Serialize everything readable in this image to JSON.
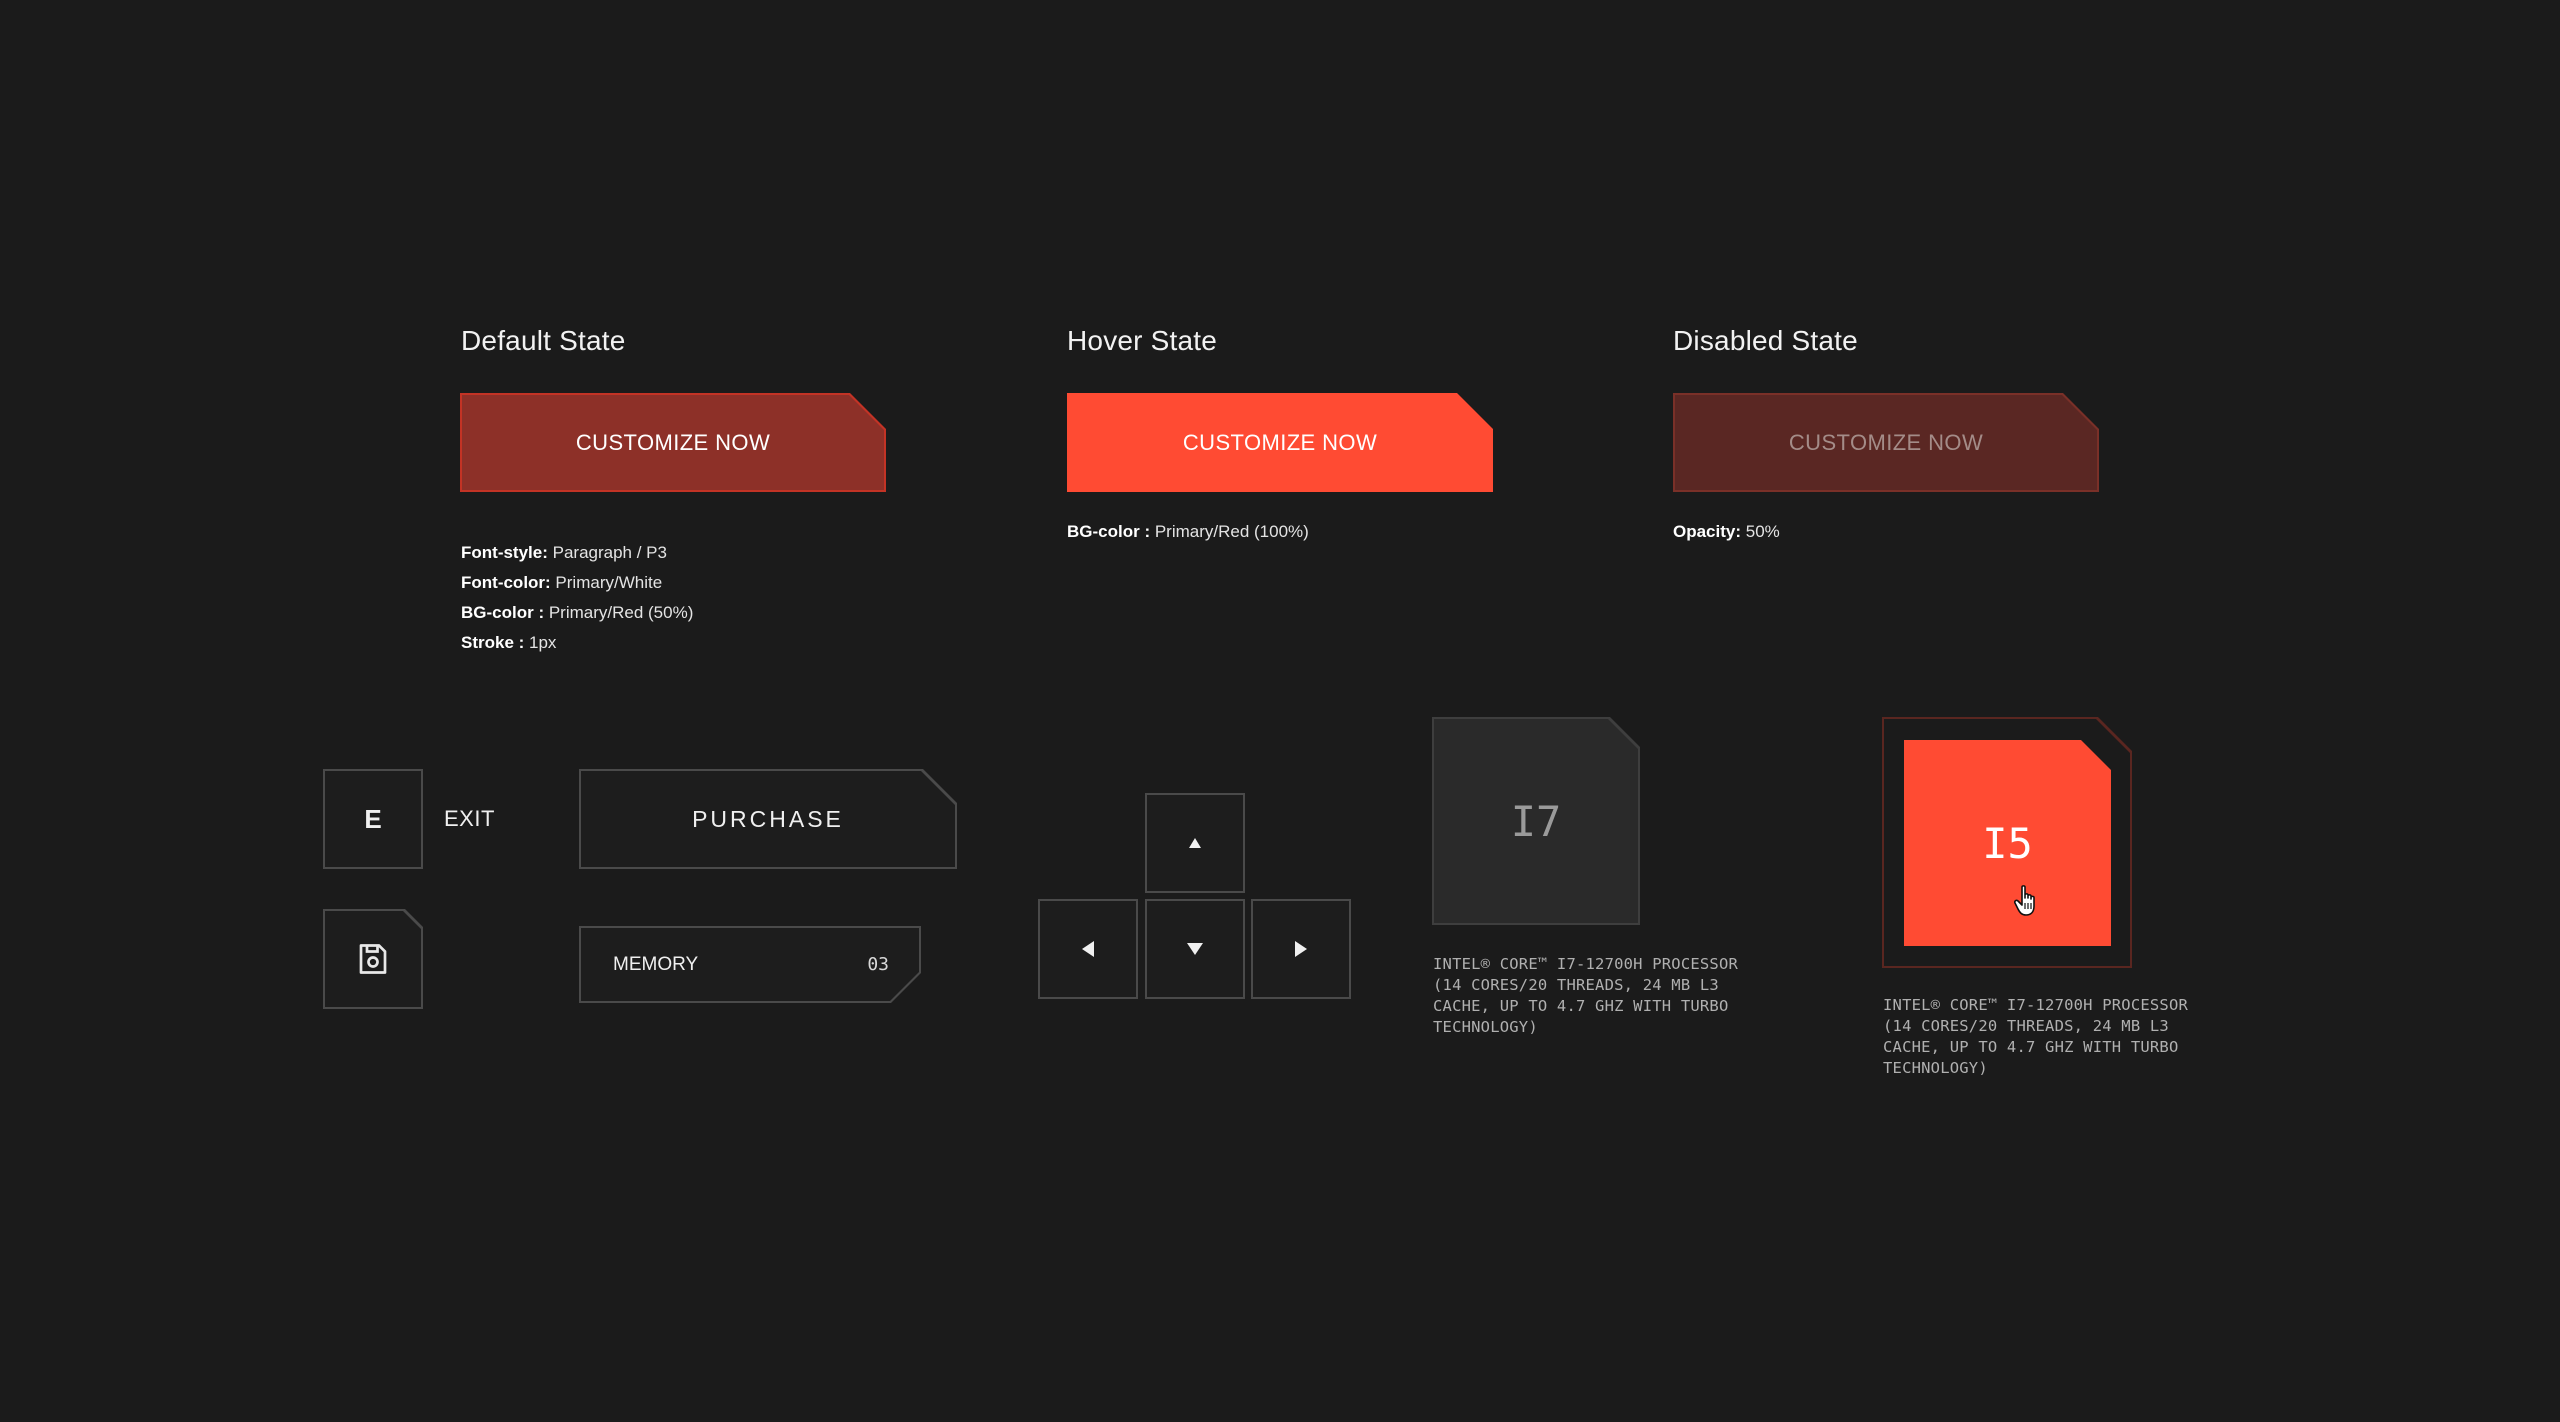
{
  "states": {
    "default": {
      "title": "Default State",
      "button": "CUSTOMIZE NOW",
      "specs": [
        {
          "label": "Font-style:",
          "value": " Paragraph / P3"
        },
        {
          "label": "Font-color:",
          "value": " Primary/White"
        },
        {
          "label": "BG-color :",
          "value": " Primary/Red (50%)"
        },
        {
          "label": "Stroke :",
          "value": " 1px"
        }
      ]
    },
    "hover": {
      "title": "Hover State",
      "button": "CUSTOMIZE NOW",
      "specs": [
        {
          "label": "BG-color :",
          "value": " Primary/Red (100%)"
        }
      ]
    },
    "disabled": {
      "title": "Disabled State",
      "button": "CUSTOMIZE NOW",
      "specs": [
        {
          "label": "Opacity:",
          "value": " 50%"
        }
      ]
    }
  },
  "controls": {
    "key_e": "E",
    "exit_label": "EXIT",
    "purchase": "PURCHASE",
    "memory_label": "MEMORY",
    "memory_value": "03"
  },
  "cpus": [
    {
      "label": "I7",
      "description": "INTEL® CORE™ I7-12700H PROCESSOR (14 CORES/20 THREADS, 24 MB L3 CACHE, UP TO 4.7 GHZ WITH TURBO TECHNOLOGY)",
      "selected": false
    },
    {
      "label": "I5",
      "description": "INTEL® CORE™ I7-12700H PROCESSOR (14 CORES/20 THREADS, 24 MB L3 CACHE, UP TO 4.7 GHZ WITH TURBO TECHNOLOGY)",
      "selected": true
    }
  ],
  "colors": {
    "background": "#1b1b1b",
    "primary_red": "#ff4b33",
    "primary_red_50": "#8d3028",
    "panel": "#2a2a2a",
    "stroke": "#4a4a4a"
  },
  "icons": [
    "save-icon",
    "arrow-up-icon",
    "arrow-down-icon",
    "arrow-left-icon",
    "arrow-right-icon",
    "hand-cursor-icon"
  ]
}
